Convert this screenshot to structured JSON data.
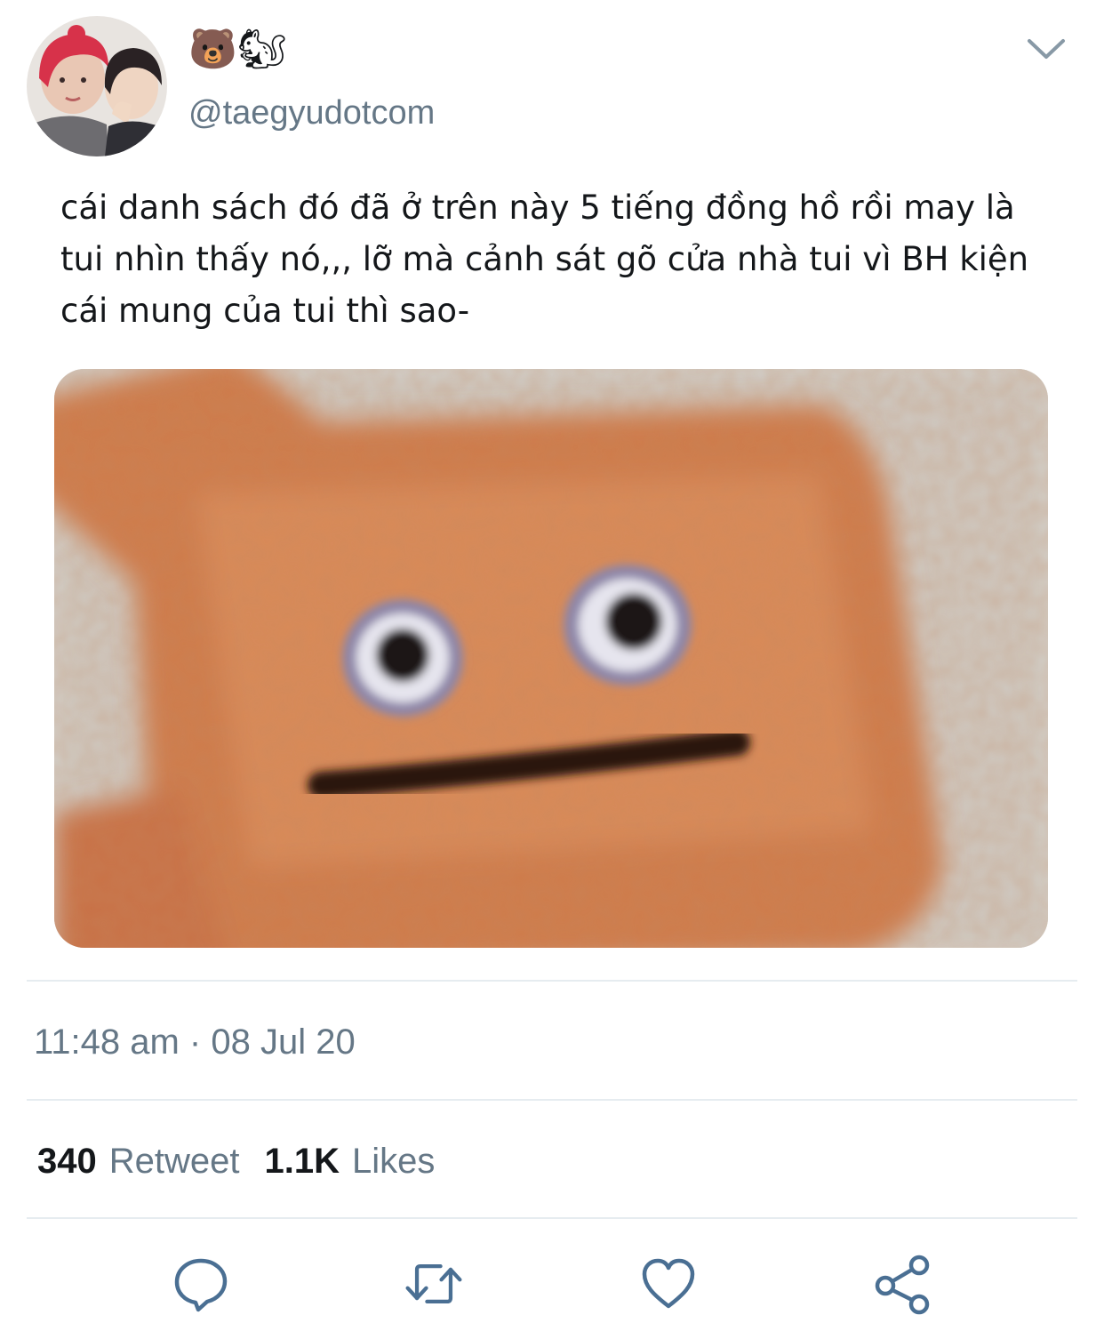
{
  "tweet": {
    "display_name_emojis": "🐻🐿",
    "handle": "@taegyudotcom",
    "text": "cái danh sách đó đã ở trên này 5 tiếng đồng hồ rồi may là tui nhìn thấy nó,,, lỡ mà cảnh sát gõ cửa nhà tui vì BH kiện cái mung của tui thì sao-",
    "timestamp": "11:48 am · 08 Jul 20"
  },
  "stats": {
    "retweets_count": "340",
    "retweets_label": "Retweet",
    "likes_count": "1.1K",
    "likes_label": "Likes"
  },
  "icons": {
    "menu": "chevron-down-icon",
    "reply": "reply-icon",
    "retweet": "retweet-icon",
    "like": "heart-icon",
    "share": "share-icon"
  },
  "colors": {
    "secondary_text": "#657786",
    "primary_text": "#14171a",
    "divider": "#e6ecf0",
    "icon_gray": "#8899a6",
    "action_blue": "#4a6f93"
  }
}
